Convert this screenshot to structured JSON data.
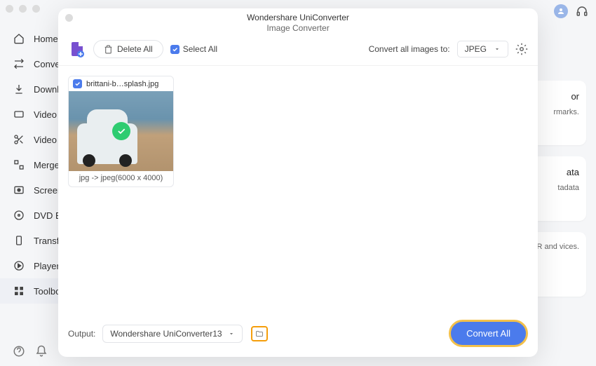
{
  "app": {
    "title": "Wondershare UniConverter",
    "modal_subtitle": "Image Converter"
  },
  "sidebar": {
    "items": [
      {
        "label": "Home"
      },
      {
        "label": "Convert"
      },
      {
        "label": "Downloa"
      },
      {
        "label": "Video C"
      },
      {
        "label": "Video E"
      },
      {
        "label": "Merger"
      },
      {
        "label": "Screen R"
      },
      {
        "label": "DVD Bu"
      },
      {
        "label": "Transfer"
      },
      {
        "label": "Player"
      },
      {
        "label": "Toolbox"
      }
    ]
  },
  "side_cards": [
    {
      "title": "or",
      "desc": "rmarks."
    },
    {
      "title": "ata",
      "desc": "tadata"
    },
    {
      "title": "",
      "desc": "R and vices."
    }
  ],
  "toolbar": {
    "delete_all": "Delete All",
    "select_all": "Select All",
    "convert_to_label": "Convert all images to:",
    "format_selected": "JPEG"
  },
  "thumbnail": {
    "filename": "brittani-b…splash.jpg",
    "caption": "jpg -> jpeg(6000 x 4000)"
  },
  "footer": {
    "output_label": "Output:",
    "output_path": "Wondershare UniConverter13",
    "convert_btn": "Convert All"
  }
}
